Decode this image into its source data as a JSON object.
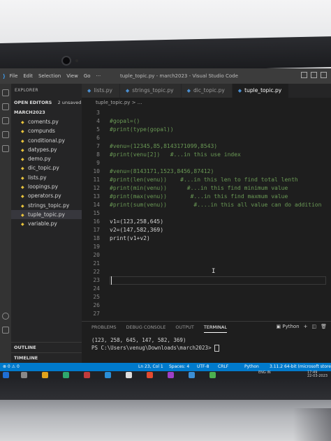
{
  "window": {
    "title": "tuple_topic.py - march2023 - Visual Studio Code"
  },
  "menu": [
    "File",
    "Edit",
    "Selection",
    "View",
    "Go",
    "···"
  ],
  "sidebar": {
    "header": "EXPLORER",
    "open_editors": "OPEN EDITORS",
    "unsaved": "2 unsaved",
    "folder": "MARCH2023",
    "files": [
      "coments.py",
      "compunds",
      "conditional.py",
      "datypes.py",
      "demo.py",
      "dic_topic.py",
      "lists.py",
      "loopings.py",
      "operators.py",
      "strings_topic.py",
      "tuple_topic.py",
      "variable.py"
    ],
    "outline": "OUTLINE",
    "timeline": "TIMELINE"
  },
  "tabs": [
    "lists.py",
    "strings_topic.py",
    "dic_topic.py",
    "tuple_topic.py"
  ],
  "breadcrumb": "tuple_topic.py > ...",
  "editor": {
    "lines": [
      {
        "n": "3",
        "text": ""
      },
      {
        "n": "4",
        "text": "#gopal=()"
      },
      {
        "n": "5",
        "text": "#print(type(gopal))"
      },
      {
        "n": "6",
        "text": ""
      },
      {
        "n": "7",
        "text": "#venu=(12345,85,8143171099,8543)"
      },
      {
        "n": "8",
        "text": "#print(venu[2])   #...in this use index"
      },
      {
        "n": "9",
        "text": ""
      },
      {
        "n": "10",
        "text": "#venu=(8143171,1523,8456,87412)"
      },
      {
        "n": "11",
        "text": "#print(len(venu))    #...in this len to find total lenth"
      },
      {
        "n": "12",
        "text": "#print(min(venu))      #...in this find minimum value"
      },
      {
        "n": "13",
        "text": "#print(max(venu))       #...in this find maxmum value"
      },
      {
        "n": "14",
        "text": "#print(sum(venu))        #....in this all value can do addition"
      },
      {
        "n": "15",
        "text": ""
      },
      {
        "n": "16",
        "text": "v1=(123,258,645)"
      },
      {
        "n": "17",
        "text": "v2=(147,582,369)"
      },
      {
        "n": "18",
        "text": "print(v1+v2)"
      },
      {
        "n": "19",
        "text": ""
      },
      {
        "n": "20",
        "text": ""
      },
      {
        "n": "21",
        "text": ""
      },
      {
        "n": "22",
        "text": ""
      },
      {
        "n": "23",
        "text": ""
      },
      {
        "n": "24",
        "text": ""
      },
      {
        "n": "25",
        "text": ""
      },
      {
        "n": "26",
        "text": ""
      },
      {
        "n": "27",
        "text": ""
      }
    ]
  },
  "panel": {
    "tabs": [
      "PROBLEMS",
      "DEBUG CONSOLE",
      "OUTPUT",
      "TERMINAL"
    ],
    "active": "TERMINAL",
    "shell": "Python",
    "output": "(123, 258, 645, 147, 582, 369)",
    "prompt": "PS C:\\Users\\venug\\Downloads\\march2023>"
  },
  "statusbar": {
    "left": "⊗ 0 ⚠ 0",
    "position": "Ln 23, Col 1",
    "spaces": "Spaces: 4",
    "encoding": "UTF-8",
    "eol": "CRLF",
    "language": "Python",
    "interpreter": "3.11.2 64-bit (microsoft store"
  },
  "taskbar": {
    "lang": "ENG IN",
    "time": "17:49",
    "date": "22-03-2023"
  },
  "colors": {
    "status": "#007acc",
    "editor_bg": "#1e1e1e",
    "comment": "#6a9955"
  }
}
